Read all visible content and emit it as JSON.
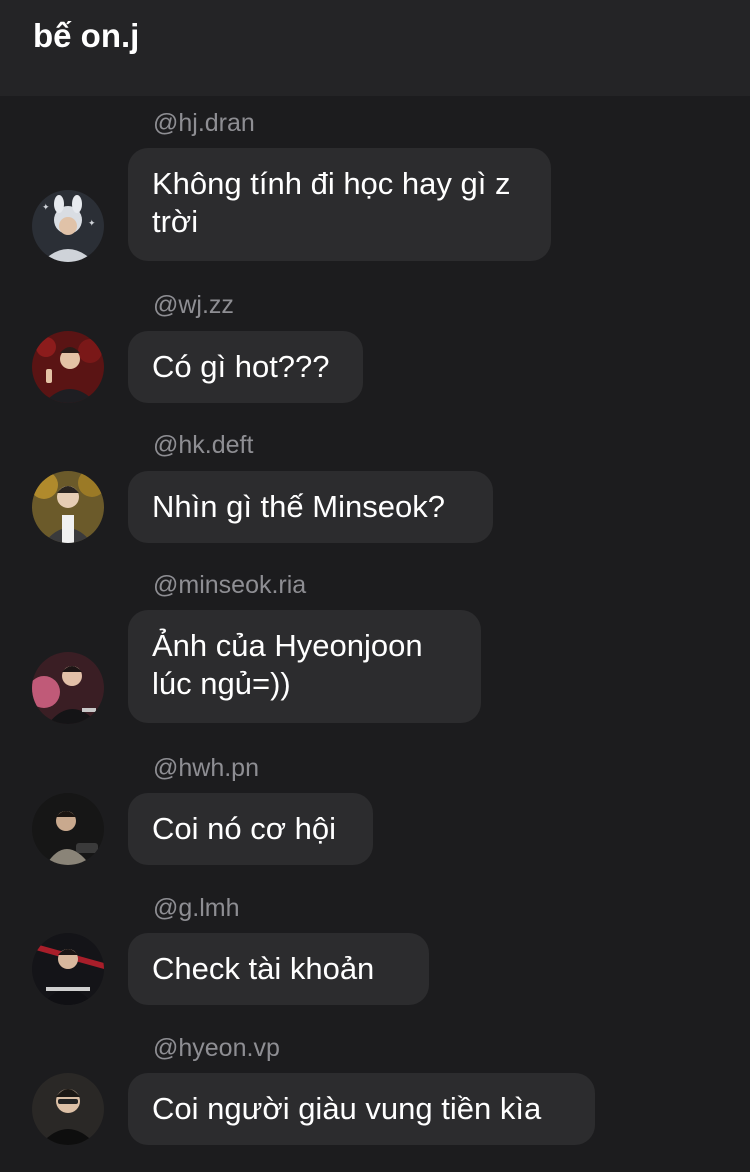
{
  "header": {
    "title": "bế on.j"
  },
  "messages": [
    {
      "username": "@hj.dran",
      "text": "Không tính đi học hay gì z trời",
      "avatar": "avatar-hj-dran"
    },
    {
      "username": "@wj.zz",
      "text": "Có gì hot???",
      "avatar": "avatar-wj-zz"
    },
    {
      "username": "@hk.deft",
      "text": "Nhìn gì thế Minseok?",
      "avatar": "avatar-hk-deft"
    },
    {
      "username": "@minseok.ria",
      "text": "Ảnh của Hyeonjoon lúc ngủ=))",
      "avatar": "avatar-minseok-ria"
    },
    {
      "username": "@hwh.pn",
      "text": "Coi nó cơ hội",
      "avatar": "avatar-hwh-pn"
    },
    {
      "username": "@g.lmh",
      "text": "Check tài khoản",
      "avatar": "avatar-g-lmh"
    },
    {
      "username": "@hyeon.vp",
      "text": "Coi người giàu vung tiền kìa",
      "avatar": "avatar-hyeon-vp"
    }
  ],
  "colors": {
    "background": "#1c1c1e",
    "header": "#242426",
    "bubble": "#2c2c2e",
    "username": "#8e8e93",
    "text": "#ffffff"
  }
}
